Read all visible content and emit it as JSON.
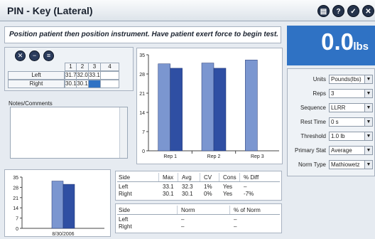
{
  "window": {
    "title": "PIN - Key (Lateral)",
    "buttons": [
      "print-icon",
      "help-icon",
      "check-icon",
      "close-icon"
    ]
  },
  "instruction": "Position patient then position instrument. Have patient exert force to begin test.",
  "readout": {
    "value": "0.0",
    "unit": "lbs"
  },
  "reps_table": {
    "headers": [
      "1",
      "2",
      "3",
      "4"
    ],
    "rows": [
      {
        "label": "Left",
        "values": [
          "31.7",
          "32.0",
          "33.1",
          ""
        ]
      },
      {
        "label": "Right",
        "values": [
          "30.1",
          "30.1",
          "",
          ""
        ]
      }
    ]
  },
  "notes": {
    "label": "Notes/Comments",
    "value": ""
  },
  "settings": [
    {
      "label": "Units",
      "value": "Pounds(lbs)"
    },
    {
      "label": "Reps",
      "value": "3"
    },
    {
      "label": "Sequence",
      "value": "LLRR"
    },
    {
      "label": "Rest Time",
      "value": "0 s"
    },
    {
      "label": "Threshold",
      "value": "1.0 lb"
    },
    {
      "label": "Primary Stat",
      "value": "Average"
    },
    {
      "label": "Norm Type",
      "value": "Mathiowetz"
    }
  ],
  "stats": {
    "headers": [
      "Side",
      "Max",
      "Avg",
      "CV",
      "Cons",
      "% Diff"
    ],
    "rows": [
      [
        "Left",
        "33.1",
        "32.3",
        "1%",
        "Yes",
        "–"
      ],
      [
        "Right",
        "30.1",
        "30.1",
        "0%",
        "Yes",
        "-7%"
      ]
    ]
  },
  "norms": {
    "headers": [
      "Side",
      "Norm",
      "% of Norm"
    ],
    "rows": [
      [
        "Left",
        "–",
        "–"
      ],
      [
        "Right",
        "–",
        "–"
      ]
    ]
  },
  "colors": {
    "left": "#7b96d0",
    "right": "#2f4fa3",
    "accent": "#2f72c4"
  },
  "chart_data": [
    {
      "type": "bar",
      "categories": [
        "Rep 1",
        "Rep 2",
        "Rep 3"
      ],
      "series": [
        {
          "values": [
            31.7,
            32.0,
            33.1
          ]
        },
        {
          "values": [
            30.1,
            30.1,
            null
          ]
        }
      ],
      "ylim": [
        0,
        35
      ],
      "yticks": [
        0,
        7,
        14,
        21,
        28,
        35
      ]
    },
    {
      "type": "bar",
      "categories": [
        "8/30/2006"
      ],
      "series": [
        {
          "values": [
            32.3
          ]
        },
        {
          "values": [
            30.1
          ]
        }
      ],
      "ylim": [
        0,
        35
      ],
      "yticks": [
        0,
        7,
        14,
        21,
        28,
        35
      ]
    }
  ]
}
